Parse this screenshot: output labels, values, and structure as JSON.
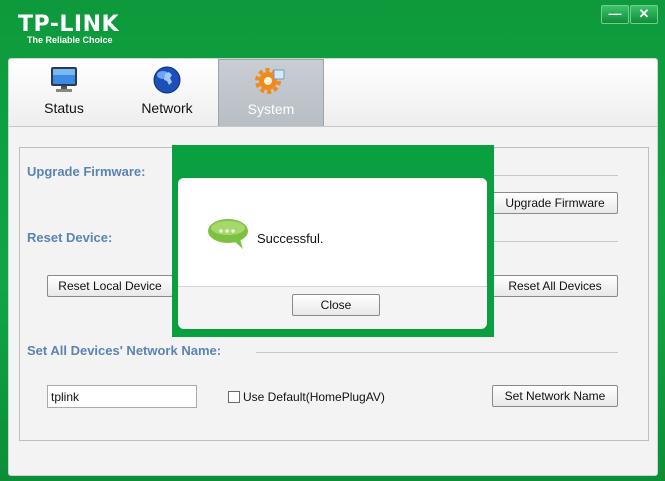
{
  "header": {
    "logo_title": "TP-LINK",
    "logo_subtitle": "The Reliable Choice",
    "minimize_label": "—",
    "close_label": "✕"
  },
  "tabs": [
    {
      "label": "Status",
      "icon": "monitor-icon"
    },
    {
      "label": "Network",
      "icon": "globe-icon"
    },
    {
      "label": "System",
      "icon": "gear-icon",
      "active": true
    }
  ],
  "system": {
    "upgrade_title": "Upgrade Firmware:",
    "upgrade_button": "Upgrade Firmware",
    "reset_title": "Reset Device:",
    "reset_local_button": "Reset Local Device",
    "reset_all_button": "Reset All Devices",
    "network_name_title": "Set All Devices' Network Name:",
    "network_name_value": "tplink",
    "use_default_label": "Use Default(HomePlugAV)",
    "use_default_checked": false,
    "set_name_button": "Set Network Name"
  },
  "dialog": {
    "message": "Successful.",
    "close_button": "Close",
    "icon": "speech-bubble-icon"
  },
  "colors": {
    "brand_green": "#11a545",
    "section_title": "#5b83b3"
  }
}
